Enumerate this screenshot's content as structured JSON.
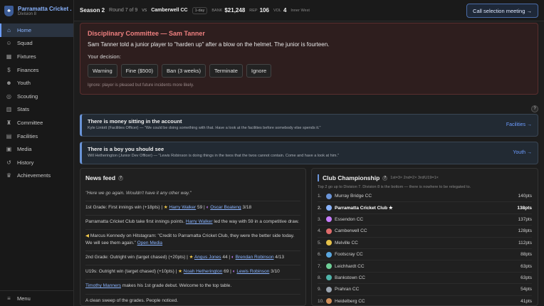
{
  "club": {
    "name": "Parramatta Cricket ...",
    "division": "Division 8"
  },
  "nav": [
    {
      "label": "Home",
      "icon": "home-icon",
      "glyph": "⌂"
    },
    {
      "label": "Squad",
      "icon": "people-icon",
      "glyph": "☺"
    },
    {
      "label": "Fixtures",
      "icon": "calendar-icon",
      "glyph": "▦"
    },
    {
      "label": "Finances",
      "icon": "money-icon",
      "glyph": "$"
    },
    {
      "label": "Youth",
      "icon": "youth-icon",
      "glyph": "☻"
    },
    {
      "label": "Scouting",
      "icon": "binoculars-icon",
      "glyph": "◎"
    },
    {
      "label": "Stats",
      "icon": "stats-icon",
      "glyph": "▥"
    },
    {
      "label": "Committee",
      "icon": "committee-icon",
      "glyph": "♜"
    },
    {
      "label": "Facilities",
      "icon": "building-icon",
      "glyph": "▤"
    },
    {
      "label": "Media",
      "icon": "media-icon",
      "glyph": "▣"
    },
    {
      "label": "History",
      "icon": "history-icon",
      "glyph": "↺"
    },
    {
      "label": "Achievements",
      "icon": "trophy-icon",
      "glyph": "♛"
    }
  ],
  "menu_label": "Menu",
  "topbar": {
    "season": "Season 2",
    "round": "Round 7 of 9",
    "vs_prefix": "vs",
    "opponent": "Camberwell CC",
    "format": "1-day",
    "bank_label": "BANK",
    "bank": "$21,248",
    "rep_label": "REP",
    "rep": "106",
    "vol_label": "VOL",
    "vol": "4",
    "region": "Inner West",
    "cta": "Call selection meeting →"
  },
  "decision": {
    "title": "Disciplinary Committee — Sam Tanner",
    "text": "Sam Tanner told a junior player to \"harden up\" after a blow on the helmet. The junior is fourteen.",
    "prompt": "Your decision:",
    "options": [
      "Warning",
      "Fine ($500)",
      "Ban (3 weeks)",
      "Terminate",
      "Ignore"
    ],
    "note": "Ignore: player is pleased but future incidents more likely."
  },
  "help": "?",
  "alerts": [
    {
      "title": "There is money sitting in the account",
      "quote": "Kyle Lintott (Facilities Officer) — \"We could be doing something with that. Have a look at the facilities before somebody else spends it.\"",
      "link": "Facilities →"
    },
    {
      "title": "There is a boy you should see",
      "quote": "Will Hetherington (Junior Dev Officer) — \"Lewis Robinson is doing things in the twos that the twos cannot contain. Come and have a look at him.\"",
      "link": "Youth →"
    }
  ],
  "news": {
    "title": "News feed",
    "help": "?",
    "items": [
      {
        "type": "italic",
        "text": "\"Here we go again. Wouldn't have it any other way.\""
      },
      {
        "type": "rich",
        "a": "1st Grade: First innings win (+18pts) | ",
        "p1": "Harry Walker",
        "b": " 59 | ",
        "p2": "Oscar Boateng",
        "c": " 3/18"
      },
      {
        "type": "rich2",
        "a": "Parramatta Cricket Club take first innings points. ",
        "p1": "Harry Walker",
        "b": " led the way with 59 in a competitive draw."
      },
      {
        "type": "rich3",
        "a": "Marcus Kennedy on Hitstagram: \"Credit to Parramatta Cricket Club, they were the better side today. We will see them again.\" ",
        "p1": "Open Media"
      },
      {
        "type": "rich",
        "a": "2nd Grade: Outright win (target chased) (+20pts) | ",
        "p1": "Angus Jones",
        "b": " 44 | ",
        "p2": "Brendan Robinson",
        "c": " 4/13"
      },
      {
        "type": "rich",
        "a": "U19s: Outright win (target chased) (+10pts) | ",
        "p1": "Noah Hetherington",
        "b": " 69 | ",
        "p2": "Lewis Robinson",
        "c": " 3/10"
      },
      {
        "type": "rich2",
        "a": "",
        "p1": "Timothy Manners",
        "b": " makes his 1st grade debut. Welcome to the top table."
      },
      {
        "type": "plain",
        "text": "A clean sweep of the grades. People noticed."
      }
    ]
  },
  "championship": {
    "title": "Club Championship",
    "help": "?",
    "weights": "1st=3× 2nd=2× 3rd/U19=1×",
    "note": "Top 2 go up to Division 7. Division 8 is the bottom — there is nowhere to be relegated to.",
    "rows": [
      {
        "pos": "1.",
        "name": "Murray Bridge CC",
        "pts": "140pts",
        "color": "#6a94d8"
      },
      {
        "pos": "2.",
        "name": "Parramatta Cricket Club ★",
        "pts": "138pts",
        "color": "#8ab4ff",
        "me": true
      },
      {
        "pos": "3.",
        "name": "Essendon CC",
        "pts": "137pts",
        "color": "#c77dff"
      },
      {
        "pos": "4.",
        "name": "Camberwell CC",
        "pts": "128pts",
        "color": "#e06c6c"
      },
      {
        "pos": "5.",
        "name": "Melville CC",
        "pts": "112pts",
        "color": "#e6c24a"
      },
      {
        "pos": "6.",
        "name": "Footscray CC",
        "pts": "88pts",
        "color": "#5aa7e0"
      },
      {
        "pos": "7.",
        "name": "Leichhardt CC",
        "pts": "63pts",
        "color": "#6fcf97"
      },
      {
        "pos": "8.",
        "name": "Bankstown CC",
        "pts": "63pts",
        "color": "#4fb3a9"
      },
      {
        "pos": "9.",
        "name": "Prahran CC",
        "pts": "54pts",
        "color": "#9aa4b0"
      },
      {
        "pos": "10.",
        "name": "Heidelberg CC",
        "pts": "41pts",
        "color": "#d08f5a"
      }
    ]
  }
}
